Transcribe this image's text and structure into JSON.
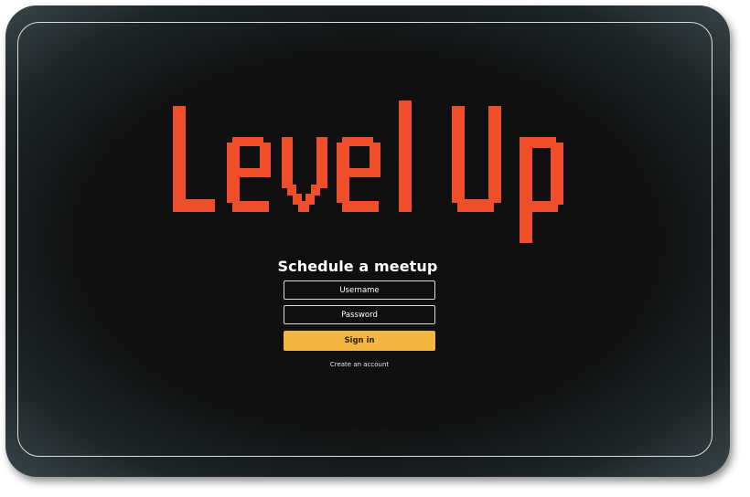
{
  "logo": {
    "text": "Level Up",
    "color": "#ef4e2a"
  },
  "form": {
    "title": "Schedule a meetup",
    "username_placeholder": "Username",
    "password_placeholder": "Password",
    "signin_label": "Sign in",
    "create_account_label": "Create an account",
    "accent_color": "#f4b63e"
  }
}
